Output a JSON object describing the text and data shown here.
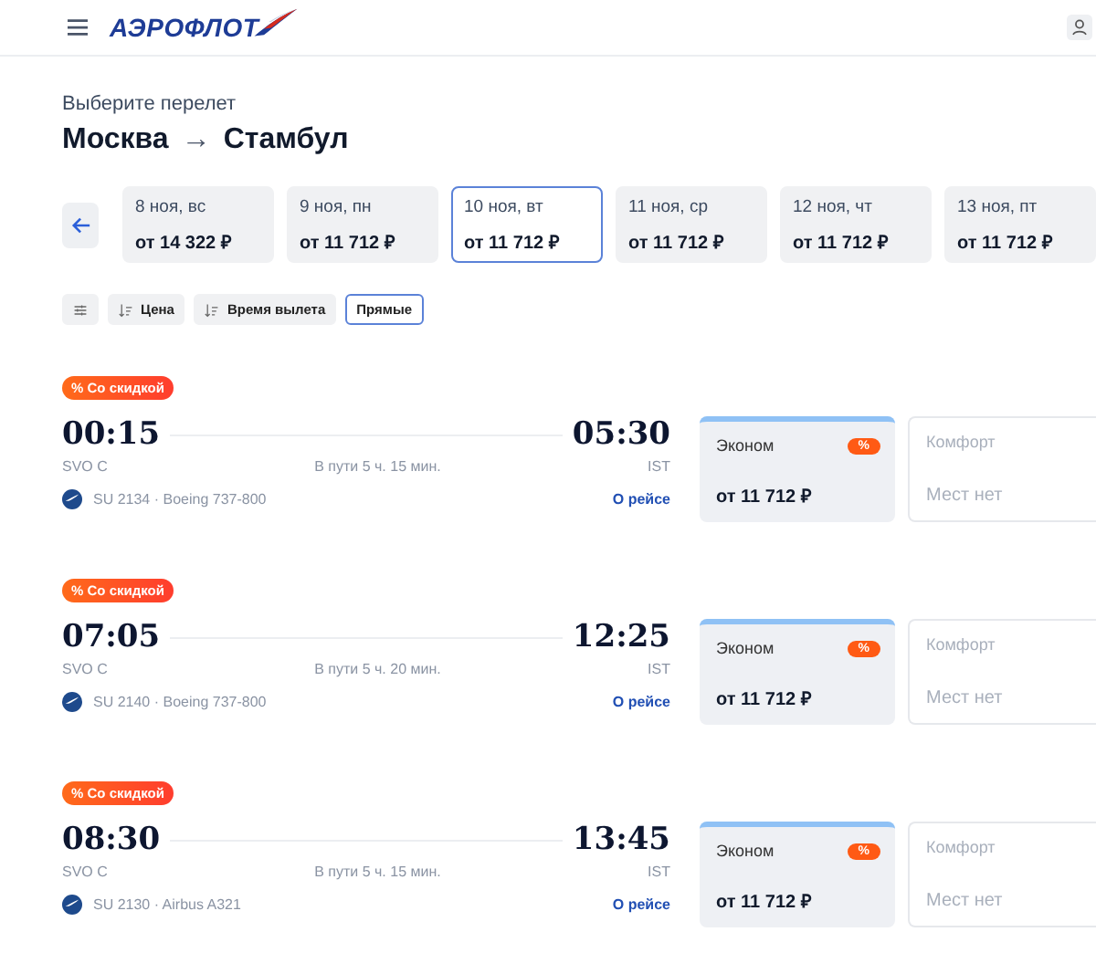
{
  "header": {
    "logo": "АЭРОФЛОТ"
  },
  "subtitle": "Выберите перелет",
  "route": {
    "from": "Москва",
    "arrow": "→",
    "to": "Стамбул"
  },
  "dates": [
    {
      "date": "8 ноя, вс",
      "price": "от 14 322 ₽",
      "selected": false
    },
    {
      "date": "9 ноя, пн",
      "price": "от 11 712 ₽",
      "selected": false
    },
    {
      "date": "10 ноя, вт",
      "price": "от 11 712 ₽",
      "selected": true
    },
    {
      "date": "11 ноя, ср",
      "price": "от 11 712 ₽",
      "selected": false
    },
    {
      "date": "12 ноя, чт",
      "price": "от 11 712 ₽",
      "selected": false
    },
    {
      "date": "13 ноя, пт",
      "price": "от 11 712 ₽",
      "selected": false
    }
  ],
  "filters": [
    {
      "kind": "settings",
      "selected": false
    },
    {
      "kind": "sort",
      "label": "Цена",
      "selected": false
    },
    {
      "kind": "sort",
      "label": "Время вылета",
      "selected": false
    },
    {
      "kind": "toggle",
      "label": "Прямые",
      "selected": true
    }
  ],
  "flights": [
    {
      "badge": "% Со скидкой",
      "departure": "00:15",
      "arrival": "05:30",
      "from": "SVO C",
      "to": "IST",
      "duration": "В пути 5 ч. 15 мин.",
      "flight": "SU 2134 · Boeing 737-800",
      "link": "О рейсе",
      "fares": [
        {
          "kind": "available",
          "class": "Эконом",
          "discount": "%",
          "price": "от 11 712 ₽"
        },
        {
          "kind": "soldout",
          "class": "Комфорт",
          "price": "Мест нет"
        }
      ]
    },
    {
      "badge": "% Со скидкой",
      "departure": "07:05",
      "arrival": "12:25",
      "from": "SVO C",
      "to": "IST",
      "duration": "В пути 5 ч. 20 мин.",
      "flight": "SU 2140 · Boeing 737-800",
      "link": "О рейсе",
      "fares": [
        {
          "kind": "available",
          "class": "Эконом",
          "discount": "%",
          "price": "от 11 712 ₽"
        },
        {
          "kind": "soldout",
          "class": "Комфорт",
          "price": "Мест нет"
        }
      ]
    },
    {
      "badge": "% Со скидкой",
      "departure": "08:30",
      "arrival": "13:45",
      "from": "SVO C",
      "to": "IST",
      "duration": "В пути 5 ч. 15 мин.",
      "flight": "SU 2130 · Airbus A321",
      "link": "О рейсе",
      "fares": [
        {
          "kind": "available",
          "class": "Эконом",
          "discount": "%",
          "price": "от 11 712 ₽"
        },
        {
          "kind": "soldout",
          "class": "Комфорт",
          "price": "Мест нет"
        }
      ]
    }
  ]
}
